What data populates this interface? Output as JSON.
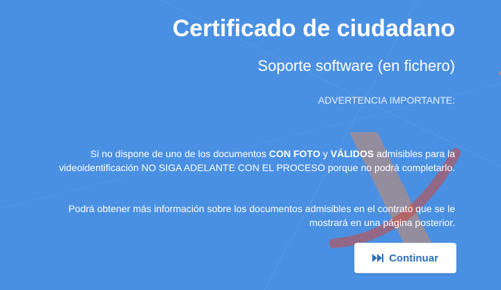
{
  "header": {
    "title": "Certificado de ciudadano",
    "subtitle": "Soporte software (en fichero)"
  },
  "notice": {
    "warning_label": "ADVERTENCIA IMPORTANTE:",
    "paragraph1": {
      "line1_pre": "Si no dispone de uno de los documentos ",
      "bold1": "CON FOTO",
      "mid": " y ",
      "bold2": "VÁLIDOS",
      "line1_post": " admisibles para la",
      "line2": "videoidentificación NO SIGA ADELANTE CON EL PROCESO porque no podrá completarlo."
    },
    "paragraph2": {
      "line1": "Podrá obtener más información sobre los documentos admisibles en el contrato que se le",
      "line2": "mostrará en una página posterior."
    }
  },
  "actions": {
    "continue_label": "Continuar",
    "continue_icon": "fast-forward-icon"
  },
  "colors": {
    "background": "#4a90e2",
    "button_text": "#2c6fbf",
    "watermark_orange": "#f08a4b",
    "watermark_red": "#d0453a"
  }
}
